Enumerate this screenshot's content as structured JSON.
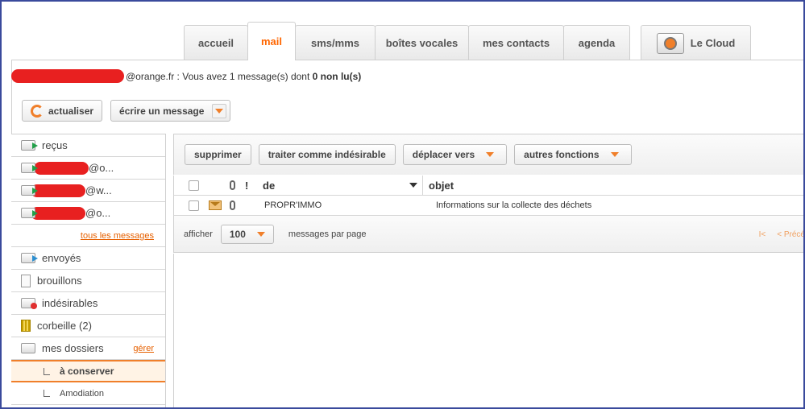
{
  "tabs": [
    {
      "label": "accueil",
      "active": false
    },
    {
      "label": "mail",
      "active": true
    },
    {
      "label": "sms/mms",
      "active": false
    },
    {
      "label": "boîtes vocales",
      "active": false
    },
    {
      "label": "mes contacts",
      "active": false
    },
    {
      "label": "agenda",
      "active": false
    }
  ],
  "cloud_tab": {
    "label": "Le Cloud",
    "icon": "cloud-orange-icon"
  },
  "account": {
    "address_suffix": "@orange.fr",
    "status_text": " : Vous avez 1 message(s) dont ",
    "unread_text": "0 non lu(s)"
  },
  "toolbar": {
    "refresh_label": "actualiser",
    "compose_label": "écrire un message"
  },
  "sidebar": {
    "inbox": "reçus",
    "alias_items": [
      "@o...",
      "@w...",
      "@o..."
    ],
    "all_messages_link": "tous les messages",
    "sent": "envoyés",
    "drafts": "brouillons",
    "spam": "indésirables",
    "trash": "corbeille (2)",
    "folders": "mes dossiers",
    "manage_link": "gérer",
    "subfolders": [
      "à conserver",
      "Amodiation"
    ]
  },
  "message_actions": {
    "delete": "supprimer",
    "mark_spam": "traiter comme indésirable",
    "move": "déplacer vers",
    "other": "autres fonctions"
  },
  "table": {
    "col_from": "de",
    "col_subject": "objet",
    "rows": [
      {
        "from": "PROPR'IMMO",
        "subject": "Informations sur la collecte des déchets"
      }
    ]
  },
  "pager": {
    "show_label": "afficher",
    "per_page_value": "100",
    "per_page_label": "messages par page",
    "first": "I<",
    "prev": "< Précé"
  },
  "colors": {
    "accent": "#ff6600",
    "redaction": "#e82020"
  }
}
